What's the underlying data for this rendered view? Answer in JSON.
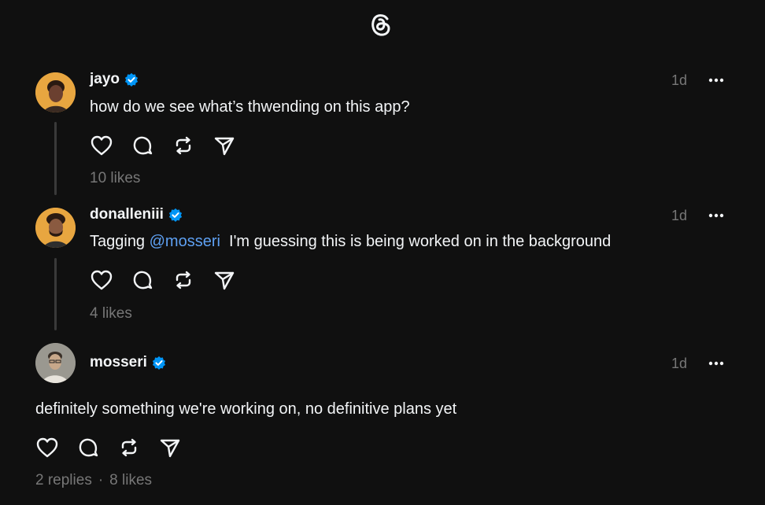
{
  "app": {
    "logo_icon": "threads-logo-icon"
  },
  "posts": [
    {
      "username": "jayo",
      "verified": true,
      "time": "1d",
      "text": "how do we see what’s thwending on this app?",
      "likes": "10 likes",
      "avatar_color": "#e8a640"
    },
    {
      "username": "donalleniii",
      "verified": true,
      "time": "1d",
      "text_prefix": "Tagging ",
      "mention": "@mosseri",
      "text_suffix": "  I'm guessing this is being worked on in the background",
      "likes": "4 likes",
      "avatar_color": "#e8a640"
    },
    {
      "username": "mosseri",
      "verified": true,
      "time": "1d",
      "text": "definitely something we're working on, no definitive plans yet",
      "replies": "2 replies",
      "separator": "·",
      "likes": "8 likes",
      "avatar_color": "#8a8a84"
    }
  ],
  "icons": {
    "like": "heart-icon",
    "comment": "comment-icon",
    "repost": "repost-icon",
    "share": "send-icon",
    "more": "more-dots-icon",
    "verified": "verified-badge-icon"
  },
  "colors": {
    "background": "#101010",
    "text": "#f3f5f7",
    "muted": "#777777",
    "mention": "#5ea0f2",
    "verified": "#0095f6"
  }
}
